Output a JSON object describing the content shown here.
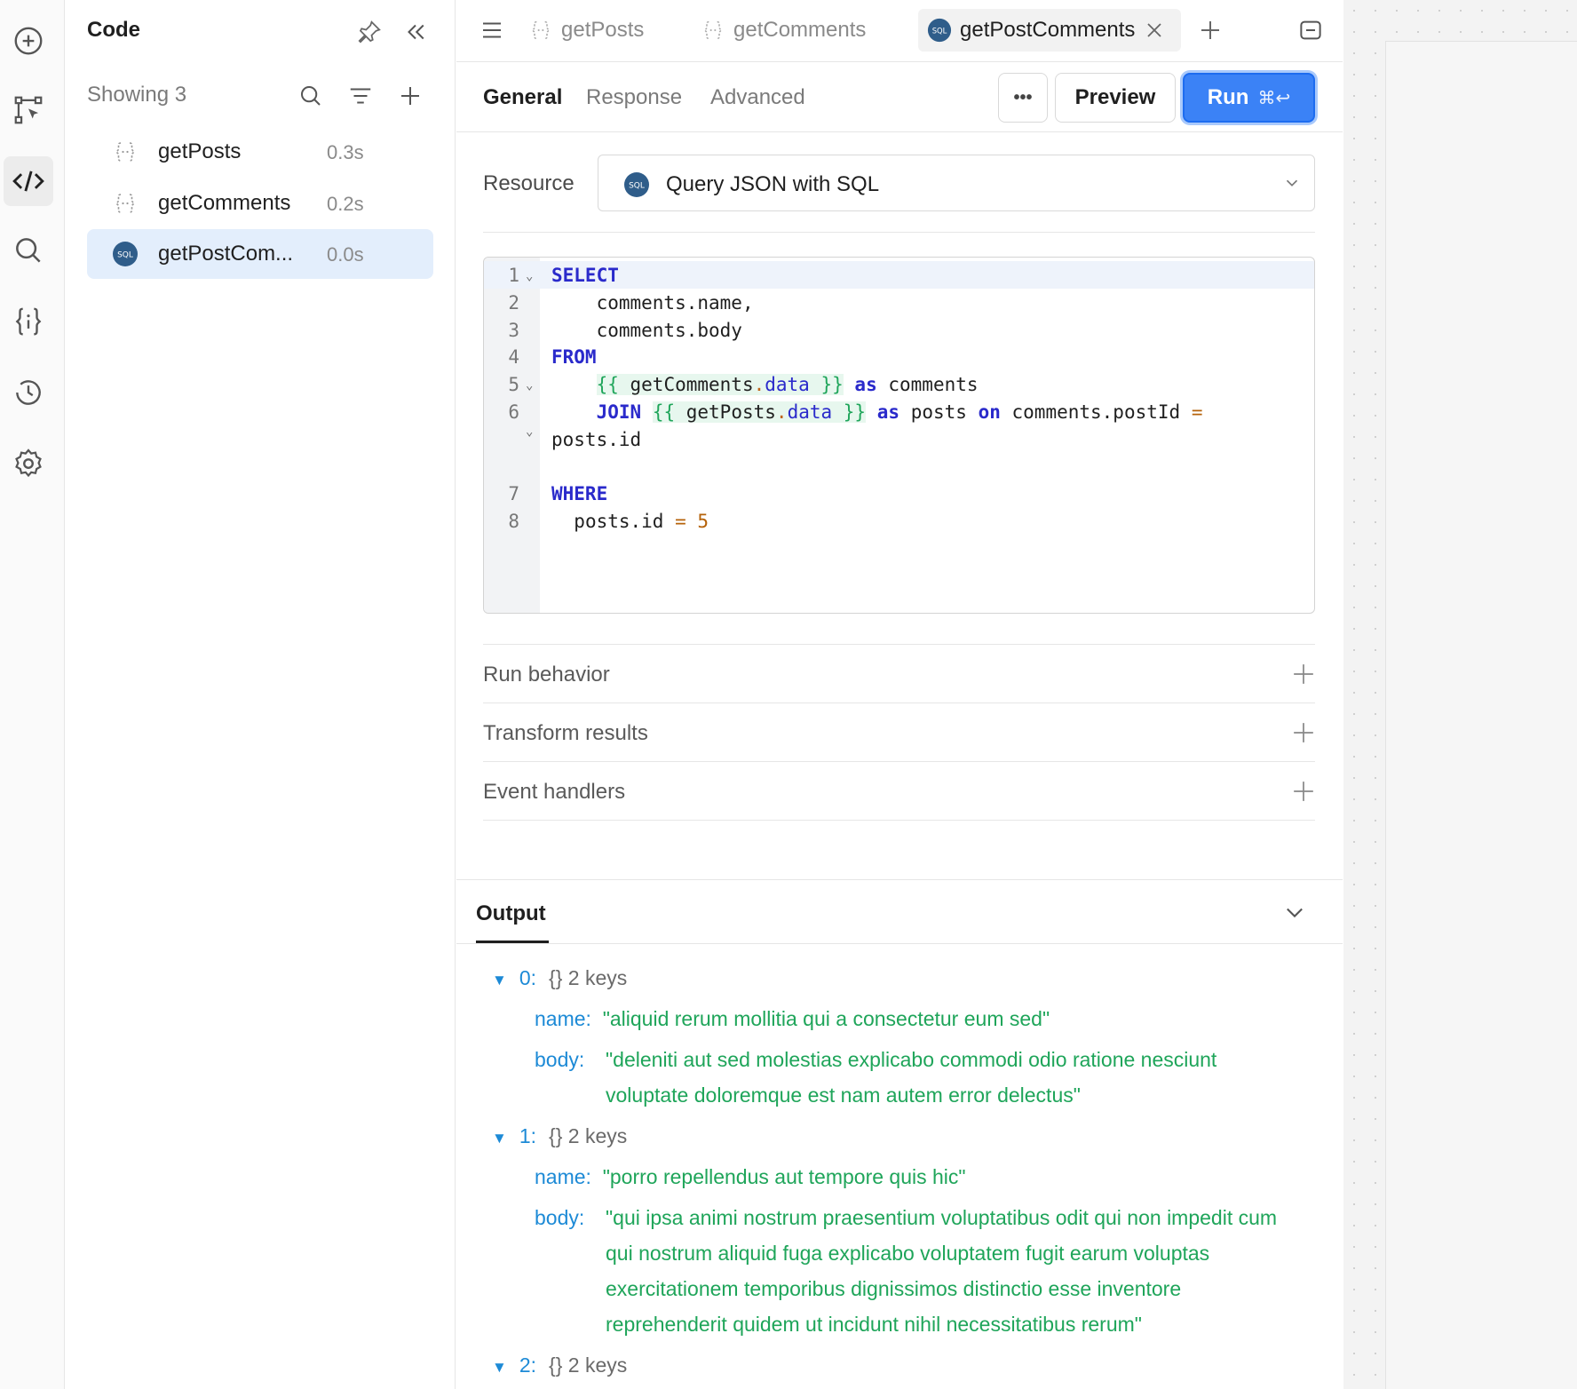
{
  "rail": {
    "items": [
      {
        "icon": "plus-circle-icon"
      },
      {
        "icon": "component-tree-icon"
      },
      {
        "icon": "code-icon",
        "active": true
      },
      {
        "icon": "search-icon"
      },
      {
        "icon": "state-braces-icon"
      },
      {
        "icon": "history-icon"
      },
      {
        "icon": "settings-gear-icon"
      }
    ]
  },
  "panel": {
    "title": "Code",
    "showing_label": "Showing 3",
    "queries": [
      {
        "name": "getPosts",
        "time": "0.3s",
        "type": "js"
      },
      {
        "name": "getComments",
        "time": "0.2s",
        "type": "js"
      },
      {
        "name": "getPostCom...",
        "time": "0.0s",
        "type": "sql",
        "active": true
      }
    ]
  },
  "tabs": [
    {
      "label": "getPosts",
      "type": "js"
    },
    {
      "label": "getComments",
      "type": "js"
    },
    {
      "label": "getPostComments",
      "type": "sql",
      "active": true
    }
  ],
  "subtabs": {
    "general": "General",
    "response": "Response",
    "advanced": "Advanced"
  },
  "buttons": {
    "more": "•••",
    "preview": "Preview",
    "run": "Run",
    "run_shortcut": "⌘↩"
  },
  "resource": {
    "label": "Resource",
    "value": "Query JSON with SQL",
    "badge": "SQL"
  },
  "code": {
    "line_numbers": [
      "1",
      "2",
      "3",
      "4",
      "5",
      "6",
      "",
      "7",
      "8"
    ],
    "tokens": {
      "select": "SELECT",
      "l2": "comments.name,",
      "l3": "comments.body",
      "from": "FROM",
      "tpl_open": "{{ ",
      "tpl_close": " }}",
      "get_comments": "getComments",
      "get_posts": "getPosts",
      "dot": ".",
      "data": "data",
      "as": "as",
      "comments_alias": "comments",
      "join": "JOIN",
      "posts_alias": "posts",
      "on": "on",
      "cond_left": "comments.postId",
      "eq": "=",
      "cond_right": "posts.id",
      "where": "WHERE",
      "where_left": "posts.id",
      "where_val": "5"
    }
  },
  "sections": [
    "Run behavior",
    "Transform results",
    "Event handlers"
  ],
  "output": {
    "title": "Output",
    "meta": "{}  2 keys",
    "rows": [
      {
        "index": "0:",
        "name": "\"aliquid rerum mollitia qui a consectetur eum sed\"",
        "body": "\"deleniti aut sed molestias explicabo commodi odio ratione nesciunt voluptate doloremque est nam autem error delectus\""
      },
      {
        "index": "1:",
        "name": "\"porro repellendus aut tempore quis hic\"",
        "body": "\"qui ipsa animi nostrum praesentium voluptatibus odit qui non impedit cum qui nostrum aliquid fuga explicabo voluptatem fugit earum voluptas exercitationem temporibus dignissimos distinctio esse inventore reprehenderit quidem ut incidunt nihil necessitatibus rerum\""
      },
      {
        "index": "2:"
      }
    ],
    "key_name": "name:",
    "key_body": "body:"
  },
  "colors": {
    "accent": "#3b82f6",
    "keyword": "#2a2acb",
    "template": "#1fa55a",
    "json_key": "#1d8ad6",
    "sql_badge": "#2f5d8a"
  }
}
